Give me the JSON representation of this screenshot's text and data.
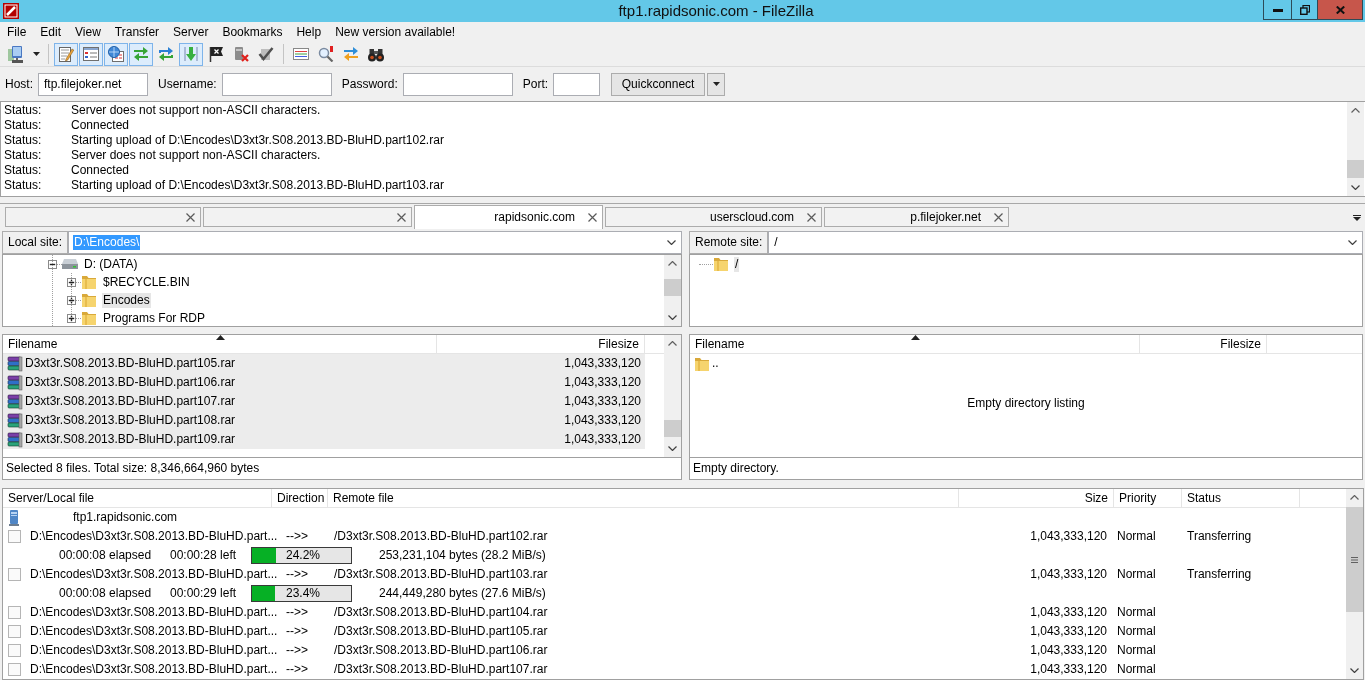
{
  "window": {
    "title": "ftp1.rapidsonic.com - FileZilla"
  },
  "menu": [
    "File",
    "Edit",
    "View",
    "Transfer",
    "Server",
    "Bookmarks",
    "Help",
    "New version available!"
  ],
  "toolbar": [
    {
      "kind": "button",
      "on": false
    },
    {
      "kind": "dropdown"
    },
    {
      "kind": "separator"
    },
    {
      "kind": "button",
      "on": true
    },
    {
      "kind": "button",
      "on": true
    },
    {
      "kind": "button",
      "on": true
    },
    {
      "kind": "button",
      "on": true
    },
    {
      "kind": "button",
      "on": false
    },
    {
      "kind": "button",
      "on": true
    },
    {
      "kind": "button",
      "on": false
    },
    {
      "kind": "button",
      "on": false
    },
    {
      "kind": "button",
      "on": false
    },
    {
      "kind": "separator"
    },
    {
      "kind": "button",
      "on": false
    },
    {
      "kind": "button",
      "on": false
    },
    {
      "kind": "button",
      "on": false
    },
    {
      "kind": "button",
      "on": false
    }
  ],
  "quickconnect": {
    "fields": [
      {
        "label": "Host:",
        "value": "ftp.filejoker.net"
      },
      {
        "label": "Username:"
      },
      {
        "label": "Password:"
      },
      {
        "label": "Port:"
      }
    ],
    "button": "Quickconnect"
  },
  "message_log": [
    {
      "label": "Status:",
      "text": "Server does not support non-ASCII characters."
    },
    {
      "label": "Status:",
      "text": "Connected"
    },
    {
      "label": "Status:",
      "text": "Starting upload of D:\\Encodes\\D3xt3r.S08.2013.BD-BluHD.part102.rar"
    },
    {
      "label": "Status:",
      "text": "Server does not support non-ASCII characters."
    },
    {
      "label": "Status:",
      "text": "Connected"
    },
    {
      "label": "Status:",
      "text": "Starting upload of D:\\Encodes\\D3xt3r.S08.2013.BD-BluHD.part103.rar"
    }
  ],
  "tabs": [
    {
      "selected": false
    },
    {
      "selected": false
    },
    {
      "label": "rapidsonic.com",
      "selected": true
    },
    {
      "label": "userscloud.com",
      "selected": false
    },
    {
      "label": "p.filejoker.net",
      "selected": false
    }
  ],
  "local": {
    "site_label": "Local site:",
    "path": {
      "value": "D:\\Encodes\\",
      "selected": true
    },
    "tree": [
      {
        "kind": "drive",
        "label": "D: (DATA)",
        "expanded": true,
        "selected": false,
        "children": [
          {
            "kind": "folder",
            "label": "$RECYCLE.BIN",
            "expanded": false,
            "selected": false
          },
          {
            "kind": "folder",
            "label": "Encodes",
            "expanded": false,
            "selected": true
          },
          {
            "kind": "folder",
            "label": "Programs For RDP",
            "expanded": false,
            "selected": false
          }
        ]
      }
    ],
    "columns": [
      {
        "label": "Filename",
        "sorted": true
      },
      {
        "label": "Filesize",
        "sorted": false
      }
    ],
    "files": [
      {
        "kind": "archive",
        "name": "D3xt3r.S08.2013.BD-BluHD.part105.rar",
        "size": "1,043,333,120",
        "selected": true
      },
      {
        "kind": "archive",
        "name": "D3xt3r.S08.2013.BD-BluHD.part106.rar",
        "size": "1,043,333,120",
        "selected": true
      },
      {
        "kind": "archive",
        "name": "D3xt3r.S08.2013.BD-BluHD.part107.rar",
        "size": "1,043,333,120",
        "selected": true
      },
      {
        "kind": "archive",
        "name": "D3xt3r.S08.2013.BD-BluHD.part108.rar",
        "size": "1,043,333,120",
        "selected": true
      },
      {
        "kind": "archive",
        "name": "D3xt3r.S08.2013.BD-BluHD.part109.rar",
        "size": "1,043,333,120",
        "selected": true
      }
    ],
    "status": "Selected 8 files. Total size: 8,346,664,960 bytes"
  },
  "remote": {
    "site_label": "Remote site:",
    "path": {
      "value": "/",
      "selected": false
    },
    "tree": [
      {
        "kind": "folder",
        "label": "/",
        "selected": true
      }
    ],
    "columns": [
      {
        "label": "Filename",
        "sorted": true
      },
      {
        "label": "Filesize",
        "sorted": false
      }
    ],
    "files": [
      {
        "kind": "folder",
        "name": "..",
        "selected": false
      }
    ],
    "empty_message": "Empty directory listing",
    "status": "Empty directory."
  },
  "queue": {
    "columns": [
      "Server/Local file",
      "Direction",
      "Remote file",
      "Size",
      "Priority",
      "Status"
    ],
    "rows": [
      {
        "kind": "server",
        "label": "ftp1.rapidsonic.com"
      },
      {
        "kind": "file",
        "local": "D:\\Encodes\\D3xt3r.S08.2013.BD-BluHD.part...",
        "direction": "-->>",
        "remote": "/D3xt3r.S08.2013.BD-BluHD.part102.rar",
        "size": "1,043,333,120",
        "priority": "Normal",
        "status": "Transferring"
      },
      {
        "kind": "progress",
        "elapsed": "00:00:08 elapsed",
        "left": "00:00:28 left",
        "level": 0.242,
        "percent": "24.2%",
        "transferred": "253,231,104 bytes (28.2 MiB/s)"
      },
      {
        "kind": "file",
        "local": "D:\\Encodes\\D3xt3r.S08.2013.BD-BluHD.part...",
        "direction": "-->>",
        "remote": "/D3xt3r.S08.2013.BD-BluHD.part103.rar",
        "size": "1,043,333,120",
        "priority": "Normal",
        "status": "Transferring"
      },
      {
        "kind": "progress",
        "elapsed": "00:00:08 elapsed",
        "left": "00:00:29 left",
        "level": 0.234,
        "percent": "23.4%",
        "transferred": "244,449,280 bytes (27.6 MiB/s)"
      },
      {
        "kind": "file",
        "local": "D:\\Encodes\\D3xt3r.S08.2013.BD-BluHD.part...",
        "direction": "-->>",
        "remote": "/D3xt3r.S08.2013.BD-BluHD.part104.rar",
        "size": "1,043,333,120",
        "priority": "Normal"
      },
      {
        "kind": "file",
        "local": "D:\\Encodes\\D3xt3r.S08.2013.BD-BluHD.part...",
        "direction": "-->>",
        "remote": "/D3xt3r.S08.2013.BD-BluHD.part105.rar",
        "size": "1,043,333,120",
        "priority": "Normal"
      },
      {
        "kind": "file",
        "local": "D:\\Encodes\\D3xt3r.S08.2013.BD-BluHD.part...",
        "direction": "-->>",
        "remote": "/D3xt3r.S08.2013.BD-BluHD.part106.rar",
        "size": "1,043,333,120",
        "priority": "Normal"
      },
      {
        "kind": "file",
        "local": "D:\\Encodes\\D3xt3r.S08.2013.BD-BluHD.part...",
        "direction": "-->>",
        "remote": "/D3xt3r.S08.2013.BD-BluHD.part107.rar",
        "size": "1,043,333,120",
        "priority": "Normal"
      }
    ]
  }
}
